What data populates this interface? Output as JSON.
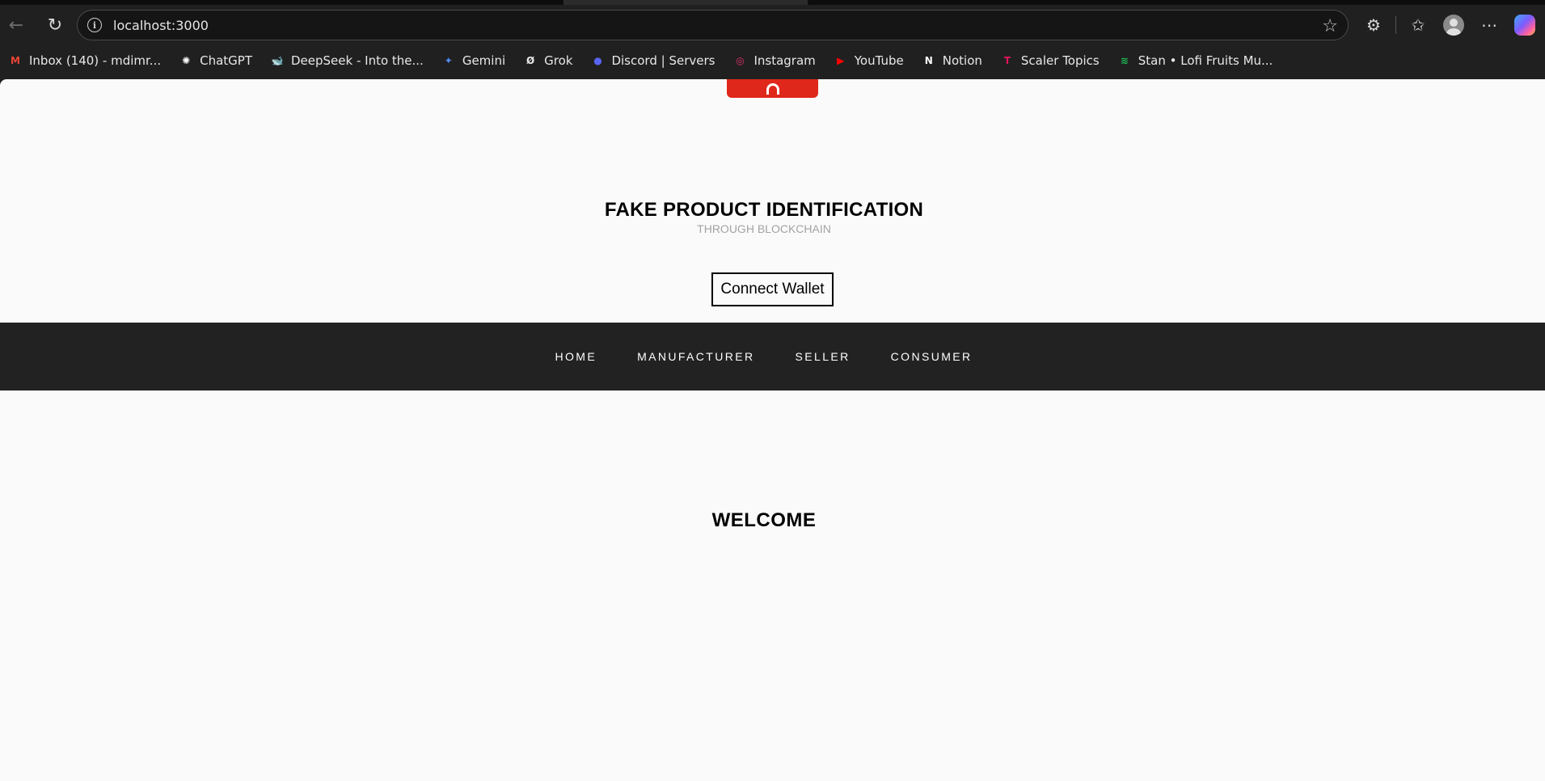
{
  "browser": {
    "url": "localhost:3000",
    "bookmarks": [
      {
        "label": "Inbox (140) - mdimr...",
        "icon": "gmail-icon",
        "glyph": "M",
        "color": "#ea4335"
      },
      {
        "label": "ChatGPT",
        "icon": "chatgpt-icon",
        "glyph": "✺",
        "color": "#ffffff"
      },
      {
        "label": "DeepSeek - Into the...",
        "icon": "deepseek-icon",
        "glyph": "🐋",
        "color": "#4d6bfe"
      },
      {
        "label": "Gemini",
        "icon": "gemini-icon",
        "glyph": "✦",
        "color": "#4f8df5"
      },
      {
        "label": "Grok",
        "icon": "grok-icon",
        "glyph": "Ø",
        "color": "#e8e8e8"
      },
      {
        "label": "Discord | Servers",
        "icon": "discord-icon",
        "glyph": "●",
        "color": "#5865f2"
      },
      {
        "label": "Instagram",
        "icon": "instagram-icon",
        "glyph": "◎",
        "color": "#e1306c"
      },
      {
        "label": "YouTube",
        "icon": "youtube-icon",
        "glyph": "▶",
        "color": "#ff0000"
      },
      {
        "label": "Notion",
        "icon": "notion-icon",
        "glyph": "N",
        "color": "#ffffff"
      },
      {
        "label": "Scaler Topics",
        "icon": "scaler-icon",
        "glyph": "T",
        "color": "#e3165b"
      },
      {
        "label": "Stan • Lofi Fruits Mu...",
        "icon": "spotify-icon",
        "glyph": "≋",
        "color": "#1db954"
      }
    ]
  },
  "page": {
    "title": "FAKE PRODUCT IDENTIFICATION",
    "subtitle": "THROUGH BLOCKCHAIN",
    "connect_label": "Connect Wallet",
    "nav": {
      "home": "HOME",
      "manufacturer": "MANUFACTURER",
      "seller": "SELLER",
      "consumer": "CONSUMER"
    },
    "welcome": "WELCOME"
  },
  "colors": {
    "accent_red": "#e0271b",
    "navbar_bg": "#222222",
    "page_bg": "#fafafa"
  }
}
